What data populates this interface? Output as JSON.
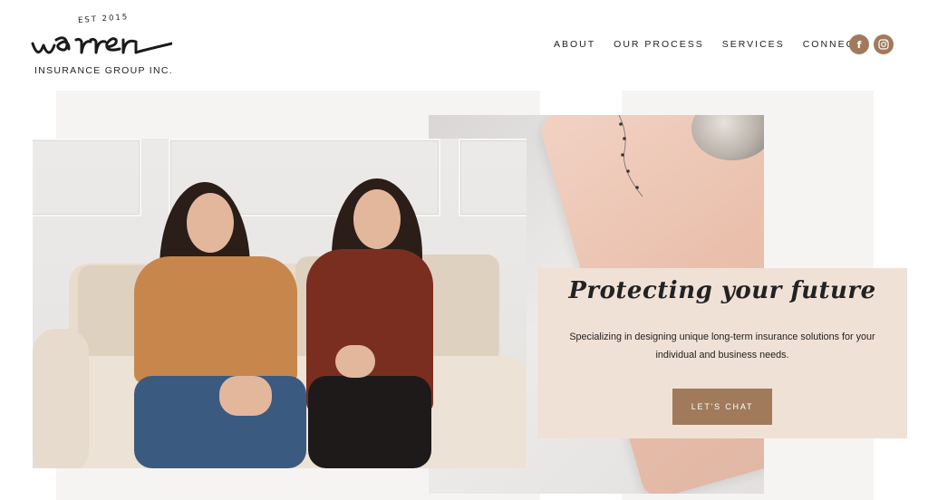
{
  "brand": {
    "est": "EST 2015",
    "name": "warren",
    "subtitle": "INSURANCE GROUP INC."
  },
  "nav": {
    "items": [
      {
        "label": "ABOUT"
      },
      {
        "label": "OUR PROCESS"
      },
      {
        "label": "SERVICES"
      },
      {
        "label": "CONNECT"
      }
    ]
  },
  "social": {
    "facebook_glyph": "f",
    "instagram_glyph": "◎",
    "icons": [
      "facebook-icon",
      "instagram-icon"
    ],
    "color": "#a07a5a"
  },
  "hero": {
    "title": "Protecting your future",
    "description": "Specializing in designing unique long-term insurance solutions for your individual and business needs.",
    "cta_label": "LET'S CHAT",
    "card_color": "#f0e1d7",
    "accent_color": "#a07a5a"
  }
}
